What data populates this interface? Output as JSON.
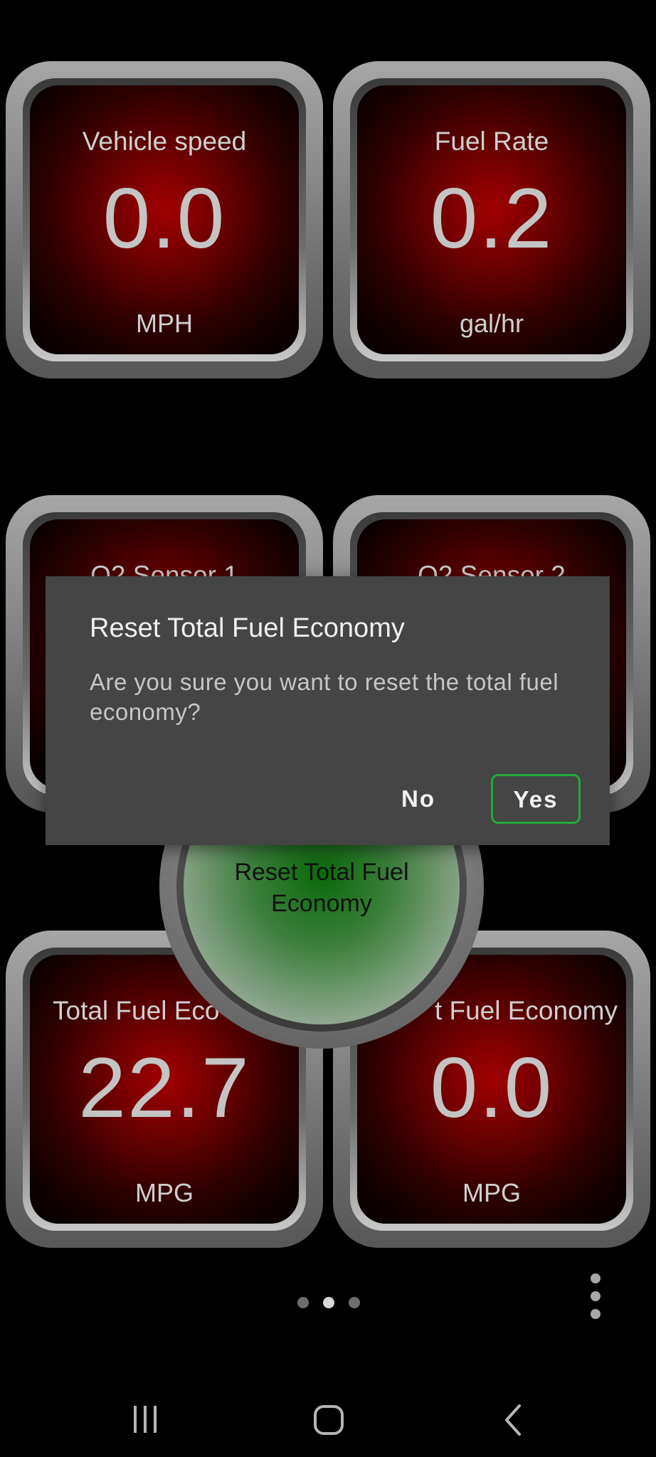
{
  "gauges": [
    {
      "label": "Vehicle speed",
      "value": "0.0",
      "unit": "MPH"
    },
    {
      "label": "Fuel Rate",
      "value": "0.2",
      "unit": "gal/hr"
    },
    {
      "label": "O2 Sensor 1",
      "value": "",
      "unit": ""
    },
    {
      "label": "O2 Sensor 2",
      "value": "",
      "unit": ""
    },
    {
      "label": "Total Fuel Eco",
      "value": "22.7",
      "unit": "MPG"
    },
    {
      "label": "t Fuel Economy",
      "value": "0.0",
      "unit": "MPG"
    }
  ],
  "round_button": {
    "label": "Reset Total Fuel Economy"
  },
  "dialog": {
    "title": "Reset Total Fuel Economy",
    "message": "Are you sure you want to reset the total fuel economy?",
    "no_label": "No",
    "yes_label": "Yes"
  },
  "pager": {
    "count": 3,
    "active_index": 1
  },
  "colors": {
    "background": "#000000",
    "gauge_face": "#a10000",
    "dialog_bg": "#454545",
    "accent": "#22a83a"
  },
  "icons": {
    "more": "vertical-ellipsis-icon",
    "nav_recents": "recents-icon",
    "nav_home": "home-icon",
    "nav_back": "back-icon"
  }
}
